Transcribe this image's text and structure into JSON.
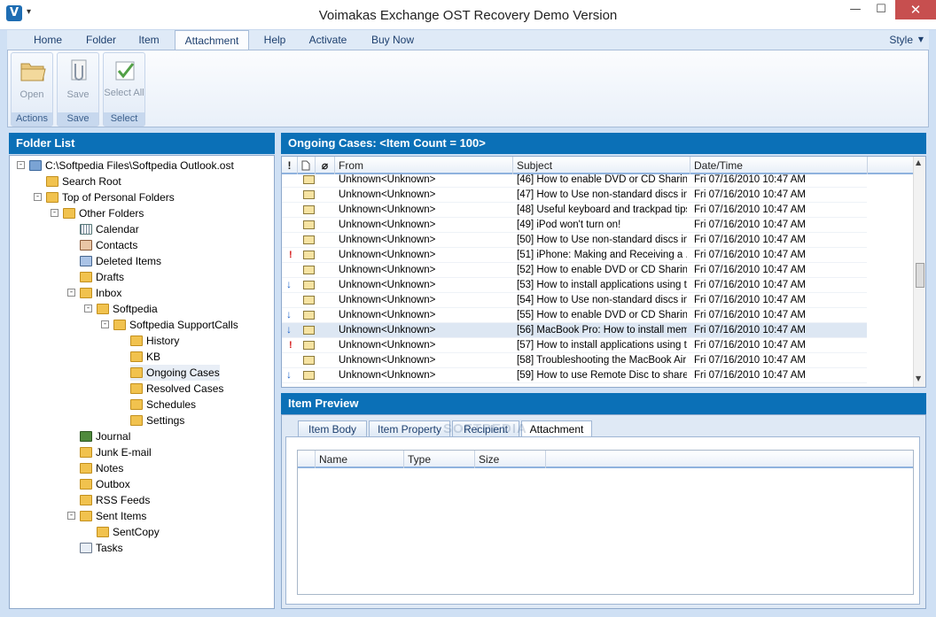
{
  "window": {
    "title": "Voimakas Exchange OST Recovery Demo Version"
  },
  "ribbon": {
    "tabs": [
      "Home",
      "Folder",
      "Item",
      "Attachment",
      "Help",
      "Activate",
      "Buy Now"
    ],
    "active_tab": "Attachment",
    "style_label": "Style",
    "groups": [
      {
        "button": "Open",
        "group": "Actions"
      },
      {
        "button": "Save",
        "group": "Save"
      },
      {
        "button": "Select All",
        "group": "Select"
      }
    ]
  },
  "folder_list": {
    "title": "Folder List",
    "items": [
      {
        "label": "C:\\Softpedia Files\\Softpedia Outlook.ost",
        "icon": "pst-icon"
      },
      {
        "label": "Search Root",
        "icon": "folder-icon"
      },
      {
        "label": "Top of Personal Folders",
        "icon": "folder-icon"
      },
      {
        "label": "Other Folders",
        "icon": "folder-icon"
      },
      {
        "label": "Calendar",
        "icon": "calendar-icon"
      },
      {
        "label": "Contacts",
        "icon": "contacts-icon"
      },
      {
        "label": "Deleted Items",
        "icon": "deleted-icon"
      },
      {
        "label": "Drafts",
        "icon": "drafts-icon"
      },
      {
        "label": "Inbox",
        "icon": "inbox-icon"
      },
      {
        "label": "Softpedia",
        "icon": "folder-icon"
      },
      {
        "label": "Softpedia SupportCalls",
        "icon": "folder-icon"
      },
      {
        "label": "History",
        "icon": "folder-icon"
      },
      {
        "label": "KB",
        "icon": "folder-icon"
      },
      {
        "label": "Ongoing Cases",
        "icon": "folder-icon"
      },
      {
        "label": "Resolved Cases",
        "icon": "folder-icon"
      },
      {
        "label": "Schedules",
        "icon": "folder-icon"
      },
      {
        "label": "Settings",
        "icon": "folder-icon"
      },
      {
        "label": "Journal",
        "icon": "journal-icon"
      },
      {
        "label": "Junk E-mail",
        "icon": "folder-icon"
      },
      {
        "label": "Notes",
        "icon": "notes-icon"
      },
      {
        "label": "Outbox",
        "icon": "outbox-icon"
      },
      {
        "label": "RSS Feeds",
        "icon": "folder-icon"
      },
      {
        "label": "Sent Items",
        "icon": "sent-icon"
      },
      {
        "label": "SentCopy",
        "icon": "folder-icon"
      },
      {
        "label": "Tasks",
        "icon": "tasks-icon"
      }
    ]
  },
  "message_list": {
    "title": "Ongoing Cases: <Item Count = 100>",
    "columns": [
      "!",
      "From",
      "Subject",
      "Date/Time"
    ],
    "rows": [
      {
        "flag": "",
        "from": "Unknown<Unknown>",
        "subject": "[46] How to enable DVD or CD Sharin...",
        "date": "Fri 07/16/2010 10:47 AM"
      },
      {
        "flag": "",
        "from": "Unknown<Unknown>",
        "subject": "[47] How to Use non-standard discs in ...",
        "date": "Fri 07/16/2010 10:47 AM"
      },
      {
        "flag": "",
        "from": "Unknown<Unknown>",
        "subject": "[48] Useful keyboard and trackpad tips...",
        "date": "Fri 07/16/2010 10:47 AM"
      },
      {
        "flag": "",
        "from": "Unknown<Unknown>",
        "subject": "[49] iPod won't turn on!",
        "date": "Fri 07/16/2010 10:47 AM"
      },
      {
        "flag": "",
        "from": "Unknown<Unknown>",
        "subject": "[50] How to Use non-standard discs in ...",
        "date": "Fri 07/16/2010 10:47 AM"
      },
      {
        "flag": "high",
        "from": "Unknown<Unknown>",
        "subject": "[51] iPhone: Making and Receiving a ...",
        "date": "Fri 07/16/2010 10:47 AM"
      },
      {
        "flag": "",
        "from": "Unknown<Unknown>",
        "subject": "[52] How to enable DVD or CD Sharin...",
        "date": "Fri 07/16/2010 10:47 AM"
      },
      {
        "flag": "low",
        "from": "Unknown<Unknown>",
        "subject": "[53] How to install applications using th...",
        "date": "Fri 07/16/2010 10:47 AM"
      },
      {
        "flag": "",
        "from": "Unknown<Unknown>",
        "subject": "[54] How to Use non-standard discs in ...",
        "date": "Fri 07/16/2010 10:47 AM"
      },
      {
        "flag": "low",
        "from": "Unknown<Unknown>",
        "subject": "[55] How to enable DVD or CD Sharin...",
        "date": "Fri 07/16/2010 10:47 AM"
      },
      {
        "flag": "low",
        "from": "Unknown<Unknown>",
        "subject": "[56] MacBook Pro: How to install mem...",
        "date": "Fri 07/16/2010 10:47 AM"
      },
      {
        "flag": "high",
        "from": "Unknown<Unknown>",
        "subject": "[57] How to install applications using th...",
        "date": "Fri 07/16/2010 10:47 AM"
      },
      {
        "flag": "",
        "from": "Unknown<Unknown>",
        "subject": "[58] Troubleshooting the MacBook Air ...",
        "date": "Fri 07/16/2010 10:47 AM"
      },
      {
        "flag": "low",
        "from": "Unknown<Unknown>",
        "subject": "[59] How to use Remote Disc to share ...",
        "date": "Fri 07/16/2010 10:47 AM"
      }
    ],
    "selected_index": 10
  },
  "preview": {
    "title": "Item Preview",
    "tabs": [
      "Item Body",
      "Item Property",
      "Recipient",
      "Attachment"
    ],
    "active_tab": "Attachment",
    "attachment_columns": [
      "Name",
      "Type",
      "Size"
    ]
  },
  "watermark": "SOFTPEDIA"
}
